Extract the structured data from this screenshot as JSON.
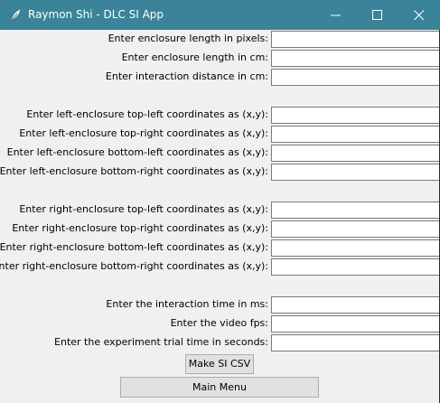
{
  "window": {
    "title": "Raymon Shi - DLC SI App",
    "app_icon": "feather-icon",
    "controls": [
      "minimize-icon",
      "maximize-icon",
      "close-icon"
    ],
    "titlebar_color": "#3a8399"
  },
  "form": {
    "rows": [
      {
        "label": "Enter enclosure length in pixels:",
        "value": ""
      },
      {
        "label": "Enter enclosure length in cm:",
        "value": ""
      },
      {
        "label": "Enter interaction distance in cm:",
        "value": ""
      },
      {
        "label": "Enter left-enclosure top-left coordinates as (x,y):",
        "value": ""
      },
      {
        "label": "Enter left-enclosure top-right coordinates as (x,y):",
        "value": ""
      },
      {
        "label": "Enter left-enclosure bottom-left coordinates as (x,y):",
        "value": ""
      },
      {
        "label": "Enter left-enclosure bottom-right coordinates as (x,y):",
        "value": ""
      },
      {
        "label": "Enter right-enclosure top-left coordinates as (x,y):",
        "value": ""
      },
      {
        "label": "Enter right-enclosure top-right coordinates as (x,y):",
        "value": ""
      },
      {
        "label": "Enter right-enclosure bottom-left coordinates as (x,y):",
        "value": ""
      },
      {
        "label": "Enter right-enclosure bottom-right coordinates as (x,y):",
        "value": ""
      },
      {
        "label": "Enter the interaction time in ms:",
        "value": ""
      },
      {
        "label": "Enter the video fps:",
        "value": ""
      },
      {
        "label": "Enter the experiment trial time in seconds:",
        "value": ""
      }
    ]
  },
  "buttons": {
    "make_csv": "Make SI CSV",
    "main_menu": "Main Menu"
  }
}
